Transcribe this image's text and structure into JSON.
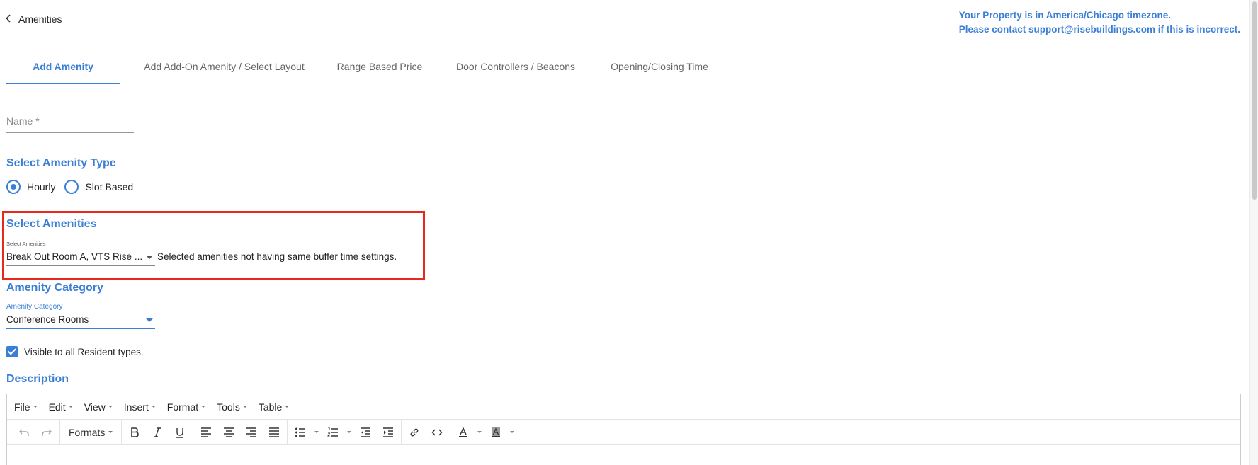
{
  "header": {
    "back_label": "Amenities",
    "timezone_line1": "Your Property is in America/Chicago timezone.",
    "timezone_line2": "Please contact support@risebuildings.com if this is incorrect."
  },
  "tabs": [
    {
      "label": "Add Amenity",
      "active": true
    },
    {
      "label": "Add Add-On Amenity / Select Layout",
      "active": false
    },
    {
      "label": "Range Based Price",
      "active": false
    },
    {
      "label": "Door Controllers / Beacons",
      "active": false
    },
    {
      "label": "Opening/Closing Time",
      "active": false
    }
  ],
  "form": {
    "name_placeholder": "Name *",
    "amenity_type_title": "Select Amenity Type",
    "amenity_type_options": [
      {
        "label": "Hourly",
        "checked": true
      },
      {
        "label": "Slot Based",
        "checked": false
      }
    ],
    "select_amenities_title": "Select Amenities",
    "select_amenities_label": "Select Amenities",
    "select_amenities_value": "Break Out Room A, VTS Rise ...",
    "buffer_warning": "Selected amenities not having same buffer time settings.",
    "category_title": "Amenity Category",
    "category_label": "Amenity Category",
    "category_value": "Conference Rooms",
    "visible_checkbox_label": "Visible to all Resident types.",
    "visible_checked": true,
    "description_title": "Description"
  },
  "editor": {
    "menus": [
      "File",
      "Edit",
      "View",
      "Insert",
      "Format",
      "Tools",
      "Table"
    ],
    "formats_label": "Formats"
  },
  "colors": {
    "accent": "#3a7fd5",
    "highlight_border": "#e8281d"
  }
}
